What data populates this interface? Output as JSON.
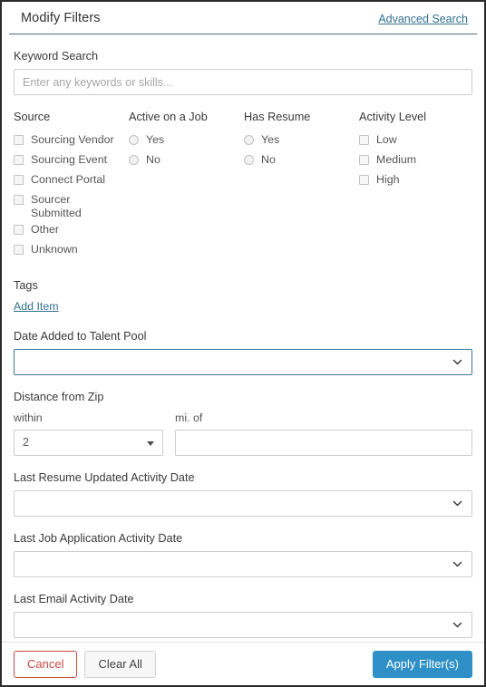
{
  "header": {
    "title": "Modify Filters",
    "advanced_search": "Advanced Search"
  },
  "keyword": {
    "label": "Keyword Search",
    "value": "",
    "placeholder": "Enter any keywords or skills..."
  },
  "columns": [
    {
      "heading": "Source",
      "type": "checkbox",
      "options": [
        {
          "label": "Sourcing Vendor",
          "checked": false
        },
        {
          "label": "Sourcing Event",
          "checked": false
        },
        {
          "label": "Connect Portal",
          "checked": false
        },
        {
          "label": "Sourcer Submitted",
          "checked": false
        },
        {
          "label": "Other",
          "checked": false
        },
        {
          "label": "Unknown",
          "checked": false
        }
      ]
    },
    {
      "heading": "Active on a Job",
      "type": "radio",
      "options": [
        {
          "label": "Yes",
          "checked": false
        },
        {
          "label": "No",
          "checked": false
        }
      ]
    },
    {
      "heading": "Has Resume",
      "type": "radio",
      "options": [
        {
          "label": "Yes",
          "checked": false
        },
        {
          "label": "No",
          "checked": false
        }
      ]
    },
    {
      "heading": "Activity Level",
      "type": "checkbox",
      "options": [
        {
          "label": "Low",
          "checked": false
        },
        {
          "label": "Medium",
          "checked": false
        },
        {
          "label": "High",
          "checked": false
        }
      ]
    }
  ],
  "tags": {
    "label": "Tags",
    "add_item": "Add Item"
  },
  "date_added": {
    "label": "Date Added to Talent Pool",
    "value": "",
    "focused": true
  },
  "distance": {
    "label": "Distance from Zip",
    "within_label": "within",
    "within_value": "2",
    "mi_of_label": "mi. of",
    "zip_value": "",
    "zip_placeholder": ""
  },
  "activity_dates": [
    {
      "label": "Last Resume Updated Activity Date",
      "value": ""
    },
    {
      "label": "Last Job Application Activity Date",
      "value": ""
    },
    {
      "label": "Last Email Activity Date",
      "value": ""
    }
  ],
  "footer": {
    "cancel": "Cancel",
    "clear_all": "Clear All",
    "apply": "Apply Filter(s)"
  },
  "colors": {
    "link": "#31708f",
    "accent_blue": "#2e90c6",
    "cancel_red": "#c9493f",
    "focus_border": "#3b7795"
  }
}
